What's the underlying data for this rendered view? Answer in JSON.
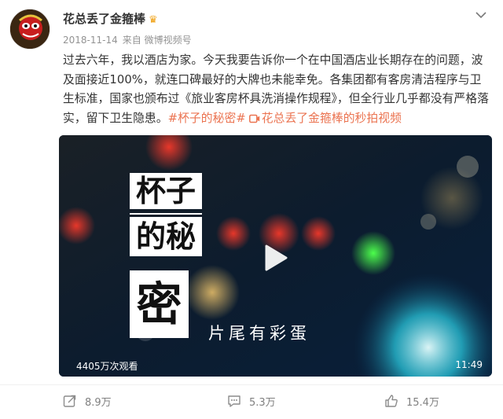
{
  "header": {
    "user_name": "花总丢了金箍棒",
    "crown_icon": "crown-icon",
    "date": "2018-11-14",
    "source": "来自 微博视频号"
  },
  "post": {
    "text": "过去六年，我以酒店为家。今天我要告诉你一个在中国酒店业长期存在的问题，波及面接近100%，就连口碑最好的大牌也未能幸免。各集团都有客房清洁程序与卫生标准，国家也颁布过《旅业客房杯具洗消操作规程》，但全行业几乎都没有严格落实，留下卫生隐患。",
    "topic": "#杯子的秘密#",
    "video_link": "花总丢了金箍棒的秒拍视频"
  },
  "video": {
    "title_line1": "杯子",
    "title_line2": "的秘",
    "title_line3": "密",
    "subtitle": "片尾有彩蛋",
    "views": "4405万次观看",
    "duration": "11:49"
  },
  "actions": {
    "repost_count": "8.9万",
    "comment_count": "5.3万",
    "like_count": "15.4万"
  },
  "colors": {
    "topic": "#eb7350",
    "meta": "#939393"
  }
}
